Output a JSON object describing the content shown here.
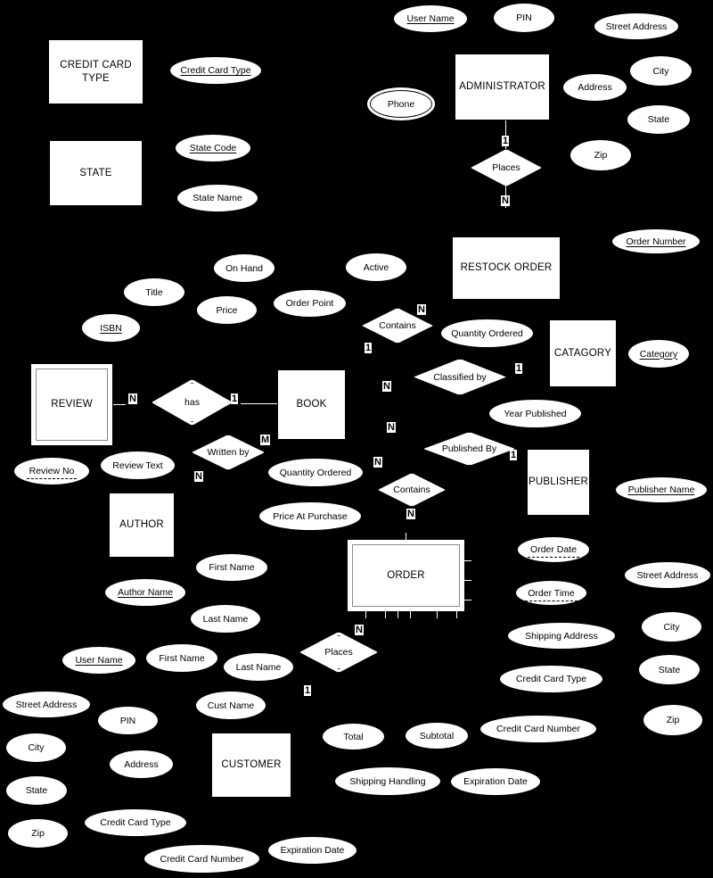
{
  "diagram": {
    "title": "Bookstore Entity-Relationship Diagram",
    "background_color": "#000000",
    "shape_fill": "#ffffff",
    "stroke_color": "#000000"
  },
  "entities": [
    {
      "id": "credit-card-type",
      "label": "CREDIT CARD TYPE",
      "weak": false
    },
    {
      "id": "state",
      "label": "STATE",
      "weak": false
    },
    {
      "id": "administrator",
      "label": "ADMINISTRATOR",
      "weak": false
    },
    {
      "id": "restock-order",
      "label": "RESTOCK ORDER",
      "weak": false
    },
    {
      "id": "catagory",
      "label": "CATAGORY",
      "weak": false
    },
    {
      "id": "review",
      "label": "REVIEW",
      "weak": true
    },
    {
      "id": "book",
      "label": "BOOK",
      "weak": false
    },
    {
      "id": "publisher",
      "label": "PUBLISHER",
      "weak": false
    },
    {
      "id": "author",
      "label": "AUTHOR",
      "weak": false
    },
    {
      "id": "order",
      "label": "ORDER",
      "weak": true
    },
    {
      "id": "customer",
      "label": "CUSTOMER",
      "weak": false
    }
  ],
  "relationships": [
    {
      "id": "places-admin",
      "label": "Places",
      "double": false,
      "cardinality": [
        "1",
        "N"
      ]
    },
    {
      "id": "contains-restock",
      "label": "Contains",
      "double": false,
      "cardinality": [
        "N",
        "1"
      ]
    },
    {
      "id": "classified-by",
      "label": "Classified by",
      "double": false,
      "cardinality": [
        "N",
        "1"
      ]
    },
    {
      "id": "has",
      "label": "has",
      "double": true,
      "cardinality": [
        "N",
        "1"
      ]
    },
    {
      "id": "written-by",
      "label": "Written by",
      "double": false,
      "cardinality": [
        "M",
        "N"
      ]
    },
    {
      "id": "published-by",
      "label": "Published By",
      "double": false,
      "cardinality": [
        "N",
        "1"
      ]
    },
    {
      "id": "contains-order",
      "label": "Contains",
      "double": false,
      "cardinality": [
        "N",
        "N"
      ]
    },
    {
      "id": "places-cust",
      "label": "Places",
      "double": true,
      "cardinality": [
        "N",
        "1"
      ]
    }
  ],
  "attributes": {
    "credit_card_type": [
      {
        "label": "Credit Card Type",
        "kind": "key"
      }
    ],
    "state": [
      {
        "label": "State Code",
        "kind": "key"
      },
      {
        "label": "State Name",
        "kind": "normal"
      }
    ],
    "administrator": [
      {
        "label": "User Name",
        "kind": "key"
      },
      {
        "label": "PIN",
        "kind": "normal"
      },
      {
        "label": "Street Address",
        "kind": "normal"
      },
      {
        "label": "City",
        "kind": "normal"
      },
      {
        "label": "State",
        "kind": "normal"
      },
      {
        "label": "Zip",
        "kind": "normal"
      },
      {
        "label": "Address",
        "kind": "normal"
      },
      {
        "label": "Phone",
        "kind": "multivalued"
      }
    ],
    "restock_order": [
      {
        "label": "Order Number",
        "kind": "key"
      },
      {
        "label": "Quantity Ordered",
        "kind": "normal"
      }
    ],
    "catagory": [
      {
        "label": "Category",
        "kind": "key"
      }
    ],
    "book": [
      {
        "label": "ISBN",
        "kind": "key"
      },
      {
        "label": "Title",
        "kind": "normal"
      },
      {
        "label": "Price",
        "kind": "normal"
      },
      {
        "label": "On Hand",
        "kind": "normal"
      },
      {
        "label": "Order Point",
        "kind": "normal"
      },
      {
        "label": "Active",
        "kind": "normal"
      }
    ],
    "publisher": [
      {
        "label": "Year Published",
        "kind": "normal"
      },
      {
        "label": "Publisher Name",
        "kind": "key"
      }
    ],
    "review": [
      {
        "label": "Review No",
        "kind": "partial-key"
      },
      {
        "label": "Review Text",
        "kind": "normal"
      }
    ],
    "author": [
      {
        "label": "Author Name",
        "kind": "key"
      },
      {
        "label": "First Name",
        "kind": "normal"
      },
      {
        "label": "Last Name",
        "kind": "normal"
      }
    ],
    "contains_order": [
      {
        "label": "Quantity Ordered",
        "kind": "normal"
      },
      {
        "label": "Price At Purchase",
        "kind": "normal"
      }
    ],
    "order": [
      {
        "label": "Order Date",
        "kind": "partial-key"
      },
      {
        "label": "Order Time",
        "kind": "partial-key"
      },
      {
        "label": "Shipping Address",
        "kind": "normal"
      },
      {
        "label": "Credit Card Type",
        "kind": "normal"
      },
      {
        "label": "Credit Card Number",
        "kind": "normal"
      },
      {
        "label": "Street Address",
        "kind": "normal"
      },
      {
        "label": "City",
        "kind": "normal"
      },
      {
        "label": "State",
        "kind": "normal"
      },
      {
        "label": "Zip",
        "kind": "normal"
      },
      {
        "label": "Total",
        "kind": "normal"
      },
      {
        "label": "Subtotal",
        "kind": "normal"
      },
      {
        "label": "Shipping Handling",
        "kind": "normal"
      },
      {
        "label": "Expiration Date",
        "kind": "normal"
      }
    ],
    "customer": [
      {
        "label": "User Name",
        "kind": "key"
      },
      {
        "label": "First Name",
        "kind": "normal"
      },
      {
        "label": "Last Name",
        "kind": "normal"
      },
      {
        "label": "Cust Name",
        "kind": "normal"
      },
      {
        "label": "Street Address",
        "kind": "normal"
      },
      {
        "label": "PIN",
        "kind": "normal"
      },
      {
        "label": "Address",
        "kind": "normal"
      },
      {
        "label": "City",
        "kind": "normal"
      },
      {
        "label": "State",
        "kind": "normal"
      },
      {
        "label": "Zip",
        "kind": "normal"
      },
      {
        "label": "Credit Card Type",
        "kind": "normal"
      },
      {
        "label": "Credit Card Number",
        "kind": "normal"
      },
      {
        "label": "Expiration Date",
        "kind": "normal"
      }
    ]
  },
  "nodes": {
    "e_credit_card_type": "CREDIT CARD TYPE",
    "e_state": "STATE",
    "e_administrator": "ADMINISTRATOR",
    "e_restock_order": "RESTOCK ORDER",
    "e_catagory": "CATAGORY",
    "e_review": "REVIEW",
    "e_book": "BOOK",
    "e_publisher": "PUBLISHER",
    "e_author": "AUTHOR",
    "e_order": "ORDER",
    "e_customer": "CUSTOMER",
    "r_places_admin": "Places",
    "r_contains_restock": "Contains",
    "r_classified_by": "Classified by",
    "r_has": "has",
    "r_written_by": "Written by",
    "r_published_by": "Published By",
    "r_contains_order": "Contains",
    "r_places_cust": "Places",
    "a_credit_card_type": "Credit Card Type",
    "a_state_code": "State Code",
    "a_state_name": "State Name",
    "a_admin_user_name": "User Name",
    "a_admin_pin": "PIN",
    "a_admin_street_address": "Street Address",
    "a_admin_city": "City",
    "a_admin_state": "State",
    "a_admin_zip": "Zip",
    "a_admin_address": "Address",
    "a_admin_phone": "Phone",
    "a_order_number": "Order Number",
    "a_restock_qty": "Quantity Ordered",
    "a_category": "Category",
    "a_isbn": "ISBN",
    "a_title": "Title",
    "a_price": "Price",
    "a_on_hand": "On Hand",
    "a_order_point": "Order Point",
    "a_active": "Active",
    "a_year_published": "Year Published",
    "a_publisher_name": "Publisher Name",
    "a_review_no": "Review No",
    "a_review_text": "Review Text",
    "a_author_name": "Author Name",
    "a_author_first": "First Name",
    "a_author_last": "Last Name",
    "a_line_qty": "Quantity Ordered",
    "a_line_price": "Price At Purchase",
    "a_order_date": "Order Date",
    "a_order_time": "Order Time",
    "a_shipping_address": "Shipping Address",
    "a_order_cc_type": "Credit Card Type",
    "a_order_cc_number": "Credit Card Number",
    "a_order_street": "Street Address",
    "a_order_city": "City",
    "a_order_state": "State",
    "a_order_zip": "Zip",
    "a_total": "Total",
    "a_subtotal": "Subtotal",
    "a_shipping_handling": "Shipping Handling",
    "a_order_exp": "Expiration Date",
    "a_cust_user_name": "User Name",
    "a_cust_first": "First Name",
    "a_cust_last": "Last Name",
    "a_cust_name": "Cust Name",
    "a_cust_street": "Street Address",
    "a_cust_pin": "PIN",
    "a_cust_address": "Address",
    "a_cust_city": "City",
    "a_cust_state": "State",
    "a_cust_zip": "Zip",
    "a_cust_cc_type": "Credit Card Type",
    "a_cust_cc_number": "Credit Card Number",
    "a_cust_exp": "Expiration Date"
  },
  "cardinality_labels": {
    "admin_places_1": "1",
    "admin_places_n": "N",
    "contains_restock_n": "N",
    "contains_restock_1": "1",
    "classified_n": "N",
    "classified_1": "1",
    "has_n": "N",
    "has_1": "1",
    "written_m": "M",
    "written_n": "N",
    "published_n": "N",
    "published_1": "1",
    "contains_order_n_top": "N",
    "contains_order_n_bottom": "N",
    "places_cust_n": "N",
    "places_cust_1": "1"
  }
}
